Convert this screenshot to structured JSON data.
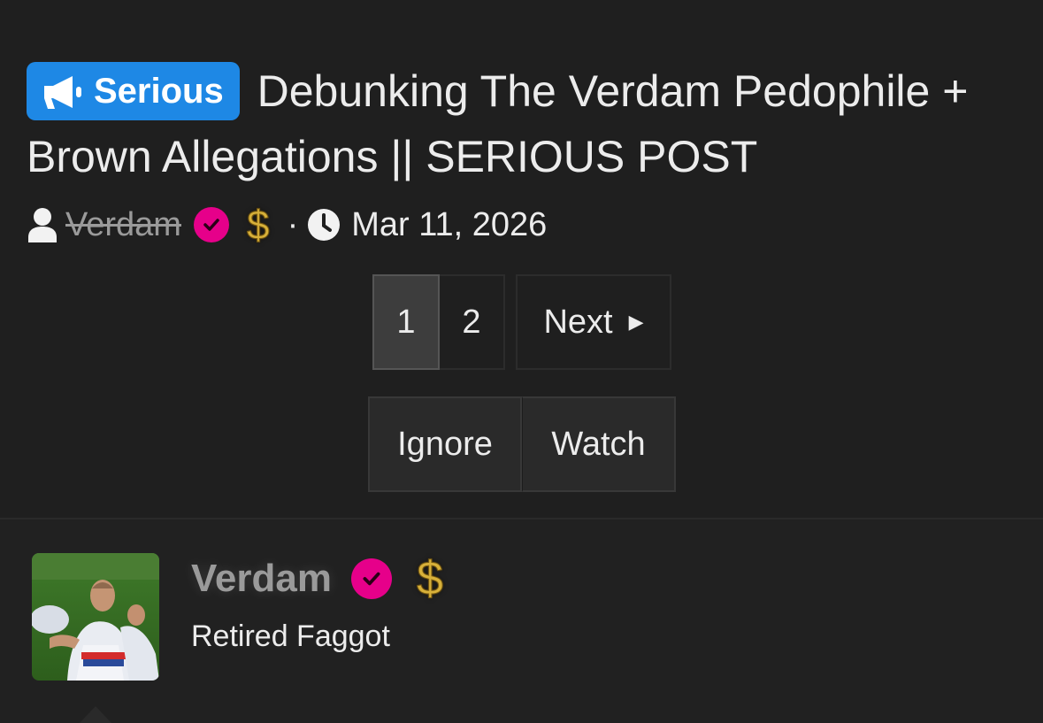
{
  "thread": {
    "prefix_label": "Serious",
    "title": "Debunking The Verdam Pedophile + Brown Allegations || SERIOUS POST",
    "author": "Verdam",
    "separator": "·",
    "date": "Mar 11, 2026"
  },
  "pagination": {
    "pages": [
      "1",
      "2"
    ],
    "current": "1",
    "next_label": "Next"
  },
  "actions": {
    "ignore_label": "Ignore",
    "watch_label": "Watch"
  },
  "post": {
    "username": "Verdam",
    "user_title": "Retired Faggot"
  },
  "badges": {
    "dollar_symbol": "$"
  },
  "colors": {
    "prefix_bg": "#1e88e5",
    "verified": "#e6008a",
    "dollar": "#d8b13a",
    "background": "#1f1f1f"
  },
  "icons": [
    "megaphone-icon",
    "user-icon",
    "verified-check-icon",
    "dollar-icon",
    "clock-icon",
    "caret-right-icon"
  ]
}
